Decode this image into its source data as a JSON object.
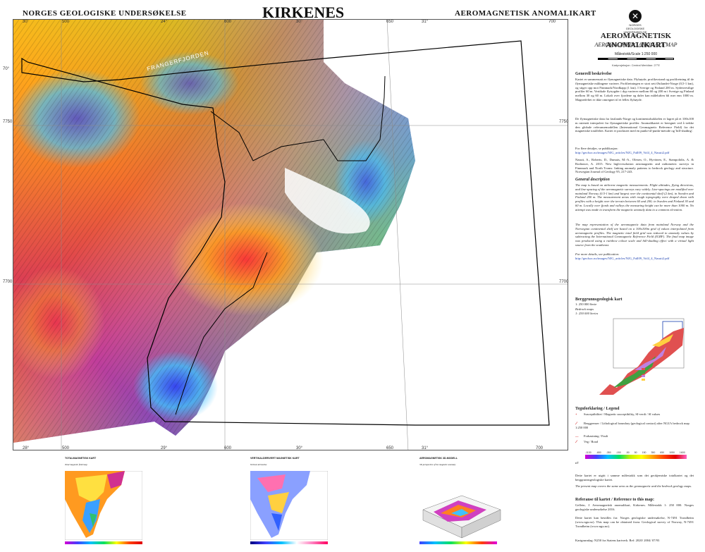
{
  "header": {
    "left": "NORGES GEOLOGISKE UNDERSØKELSE",
    "center": "KIRKENES",
    "right": "AEROMAGNETISK ANOMALIKART"
  },
  "map": {
    "place_labels": [
      "FRANGERFJORDEN"
    ],
    "top_ticks": [
      "30'",
      "500",
      "24°",
      "600",
      "30'",
      "650",
      "31°",
      "700"
    ],
    "bottom_ticks": [
      "28°",
      "500",
      "29°",
      "600",
      "30°",
      "650",
      "31°",
      "700"
    ],
    "left_ticks": [
      "70°",
      "7750",
      "7700"
    ],
    "right_ticks": [
      "7750",
      "7700"
    ]
  },
  "legend_panel": {
    "logo_mark": "✕",
    "logo_text": [
      "NORGES",
      "GEOLOGISKE",
      "UNDERSØKELSE",
      "NGU"
    ],
    "title_no": "AEROMAGNETISK ANOMALIKART",
    "title_en": "AEROMAGNETIC ANOMALY MAP",
    "scale": "Målestokk/Scale 1:250 000",
    "projection": "Kartprojeksjon: Central Meridian: 27°E",
    "general_heading": "Generell beskrivelse",
    "general_text": "Kartet er sammensatt av flymagnetiske data. Flyhøyde, profilavstand og profilretning til de flymagnetiske målingene varierer. Profilretningen er stort sett Østlandet-Norge (0,5-1 km), og stiger opp mot Finnmark/Nordkapp (1 km). I Sverige og Finland 200 m. Sydenvestlige profiler 60 m. Vertikale flytrygder i dyp varierer mellom 60 og 200 m i Sverige og Finland mellom 30 og 60 m. Lokalt over fjordene og daler kan måleluften bli mer enn 1000 m. Magnetfeltet er ikke omregnet til et felles flyhøyde.",
    "general_text2": "De flymagnetiske data fra fastlands-Norge og kontinentalsokkelen er lagret på et 100x100 m rutenett interpolert fra flymagnetiske profiler. Anomalikartet er beregnet ved å trekke den globale referansemodellen (International Geomagnetic Reference Field) fra det magnetiske totalfeltet. Kartet er produsert med en punkt-til-punkt-metode og 'hill-shading'.",
    "more_detail": "For flere detaljer, se publikasjon:",
    "link1": "http://geolsoc.no/images/NJG_articles/NJG_Fall09_Vol4_4_Nasuti2.pdf",
    "ref1": "Nasuti, A., Roberts, D., Dumais, M.-A., Olesen, O., Hyvönen, E., Stampolidis, A. & Rodionov, A. 2015. New high-resolution aeromagnetic and radiometric surveys in Finnmark and North Troms: linking anomaly patterns to bedrock geology and structure. Norwegian Journal of Geology 95, 217-243.",
    "general_en_heading": "General description",
    "general_en_text": "The map is based on airborne magnetic measurements. Flight altitudes, flying directions, and line-spacing of the aeromagnetic surveys vary widely. Line-spacings are modified over mainland Norway (0.5-1 km) and largest over the continental shelf (2 km), in Sweden and Finland 200 m. The measurement areas with rough topography were draped down with profiles with a height over the terrain between 60 and 200; in Sweden and Finland 30 and 60 m. Locally over fjords and valleys the measuring height can be more than 1000 m. No attempt was made to transform the magnetic anomaly data to a common elevation.",
    "general_en_text2": "The map representation of the aeromagnetic data from mainland Norway and the Norwegian continental shelf are based on a 100x100m grid of values interpolated from aeromagnetic profiles. The magnetic total field grid was reduced to anomaly values by subtracting the International Geomagnetic Reference Field (IGRF). The final map image was produced using a rainbow colour scale and hill-shading effect with a virtual light source from the southeast.",
    "more_detail_en": "For more details, see publication:",
    "link2": "http://geolsoc.no/images/NJG_articles/NJG_Fall09_Vol4_4_Nasuti2.pdf",
    "bedrock_heading": "Berggrunnsgeologisk kart",
    "bedrock_sub": "1: 250 000 Serie",
    "bedrock_en": "Bedrock maps",
    "bedrock_en_sub": "1: 250 000 Series",
    "legend_heading": "Tegnforklaring / Legend",
    "legend_rows": [
      {
        "sym": "+",
        "text": "Susceptibilitet / Magnetic susceptibility, SI-verdi / SI values"
      },
      {
        "sym": "⟋",
        "text": "Berggrenser / Lithological boundary (geological contact) after NGU's bedrock map 1:250 000"
      },
      {
        "sym": "—",
        "text": "Forkastning / Fault"
      },
      {
        "sym": "⟋",
        "text": "Veg / Road"
      }
    ],
    "colorbar_unit": "nT",
    "colorbar_ticks": [
      "-1130",
      "-650",
      "-350",
      "-150",
      "-50",
      "50",
      "150",
      "350",
      "650",
      "1050",
      "1600",
      "4130"
    ],
    "overlay_note": "Dette kartet er utgitt i samme målestokk som det geokjemiske totalkartet og det berggrunnsgeologiske kartet.",
    "overlay_note_en": "The present map covers the same area as the geomagnetic and the bedrock geology maps.",
    "reference_heading": "Referanse til kartet / Reference to this map:",
    "reference_text": "Gellein, J. Aeromagnetisk anomalikart, Kirkenes. Målestokk 1: 250 000. Norges geologiske undersøkelse 2016.",
    "order_text": "Dette kartet kan bestilles fra: Norges geologiske undersøkelse, N-7491 Trondheim (www.ngu.no). This map can be obtained from: Geological survey of Norway, N-7491 Trondheim (www.ngu.no).",
    "footer": "Kartgrunnlag: N250 fra Statens kartverk. Ref: 2020/ 2004/ 07/93"
  },
  "bottom_insets": [
    {
      "title": "TOTALMAGNETISK KART",
      "sub": "Total magnetic field map"
    },
    {
      "title": "VERTIKALDERIVERT MAGNETISK KART",
      "sub": "Vertical derivative"
    },
    {
      "title": "AEROMAGNETISK 3D-MODELL",
      "sub": "3D perspective of the magnetic anomaly"
    }
  ],
  "colors": {
    "frame": "#555555",
    "study_outline": "#000000",
    "grid": "#8a8a8a"
  }
}
